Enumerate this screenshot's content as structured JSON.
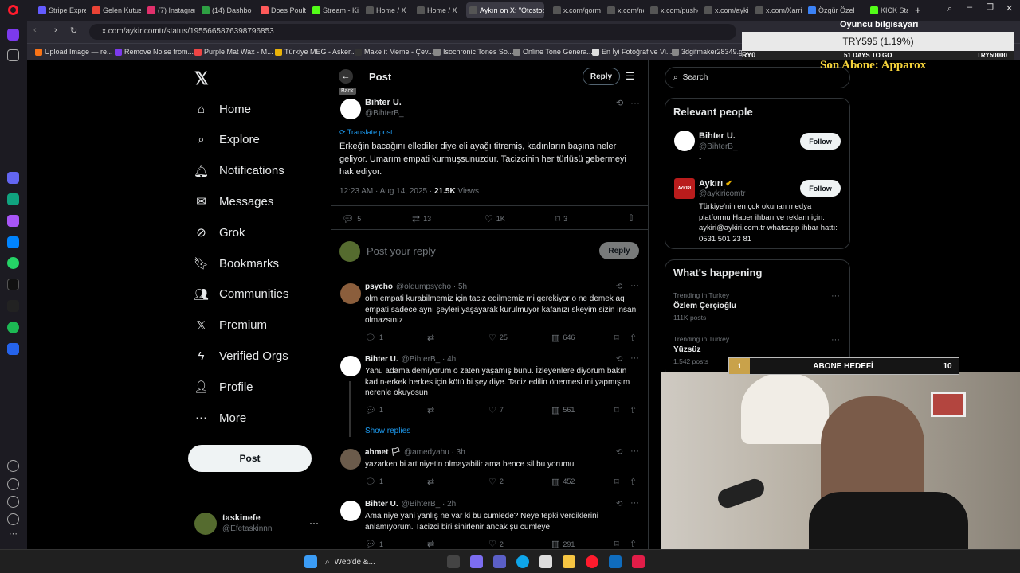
{
  "browser": {
    "tabs": [
      {
        "label": "Stripe Expres",
        "color": "#635bff"
      },
      {
        "label": "Gelen Kutusu",
        "color": "#ea4335"
      },
      {
        "label": "(7) Instagram",
        "color": "#e1306c"
      },
      {
        "label": "(14) Dashbo",
        "color": "#2ea043"
      },
      {
        "label": "Does Poultry",
        "color": "#ff5a5a"
      },
      {
        "label": "Stream - Kick",
        "color": "#53fc18"
      },
      {
        "label": "Home / X",
        "color": "#555"
      },
      {
        "label": "Home / X",
        "color": "#555"
      },
      {
        "label": "Aykırı on X: \"Otostop",
        "color": "#555"
      },
      {
        "label": "x.com/gorm",
        "color": "#555"
      },
      {
        "label": "x.com/nocor",
        "color": "#555"
      },
      {
        "label": "x.com/pushe",
        "color": "#555"
      },
      {
        "label": "x.com/aykir",
        "color": "#555"
      },
      {
        "label": "x.com/Xarria",
        "color": "#555"
      },
      {
        "label": "Özgür Özel",
        "color": "#3b82f6"
      },
      {
        "label": "KICK Status",
        "color": "#53fc18"
      }
    ],
    "url": "x.com/aykiricomtr/status/1955665876398796853",
    "bookmarks": [
      "Upload Image — re...",
      "Remove Noise from...",
      "Purple Mat Wax - M...",
      "Türkiye MEG - Asker...",
      "Make it Meme - Çev...",
      "Isochronic Tones So...",
      "Online Tone Genera...",
      "En İyi Fotoğraf ve Vi...",
      "3dgifmaker28349.gi..."
    ]
  },
  "left_nav": {
    "items": [
      "Home",
      "Explore",
      "Notifications",
      "Messages",
      "Grok",
      "Bookmarks",
      "Communities",
      "Premium",
      "Verified Orgs",
      "Profile",
      "More"
    ],
    "post_button": "Post",
    "account": {
      "name": "taskinefe",
      "handle": "@Efetaskinnn",
      "more": "···"
    }
  },
  "header": {
    "title": "Post",
    "back_tooltip": "Back",
    "reply_button": "Reply"
  },
  "post": {
    "author_name": "Bihter U.",
    "author_handle": "@BihterB_",
    "translate": "Translate post",
    "text": "Erkeğin bacağını ellediler diye eli ayağı titremiş, kadınların başına neler geliyor. Umarım empati kurmuşsunuzdur. Tacizcinin her türlüsü gebermeyi hak ediyor.",
    "timestamp": "12:23 AM · Aug 14, 2025 · ",
    "views_count": "21.5K",
    "views_label": " Views",
    "replies": "5",
    "reposts": "13",
    "likes": "1K",
    "bookmarks": "3"
  },
  "composer": {
    "placeholder": "Post your reply",
    "button": "Reply"
  },
  "replies": [
    {
      "name": "psycho",
      "handle": "@oldumpsycho · 5h",
      "text": "olm empati kurabilmemiz için taciz edilmemiz mi gerekiyor o ne demek aq empati sadece aynı şeyleri yaşayarak kurulmuyor kafanızı skeyim sizin insan olmazsınız",
      "replies": "1",
      "likes": "25",
      "views": "646"
    },
    {
      "name": "Bihter U.",
      "handle": "@BihterB_ · 4h",
      "text": "Yahu adama demiyorum o zaten yaşamış bunu. İzleyenlere diyorum bakın kadın-erkek herkes için kötü bi şey diye. Taciz edilin önermesi mi yapmışım nerenle okuyosun",
      "replies": "1",
      "likes": "7",
      "views": "561"
    },
    {
      "name": "ahmet 🏳",
      "handle": "@amedyahu · 3h",
      "text": "yazarken bi art niyetin olmayabilir ama bence sil bu yorumu",
      "replies": "1",
      "likes": "2",
      "views": "452"
    },
    {
      "name": "Bihter U.",
      "handle": "@BihterB_ · 2h",
      "text": "Ama niye yani yanlış ne var ki bu cümlede? Neye tepki verdiklerini anlamıyorum. Tacizci biri sinirlenir ancak şu cümleye.",
      "replies": "1",
      "likes": "2",
      "views": "291"
    }
  ],
  "show_replies": "Show replies",
  "right": {
    "search_placeholder": "Search",
    "relevant_title": "Relevant people",
    "people": [
      {
        "name": "Bihter U.",
        "handle": "@BihterB_",
        "bio": "-",
        "follow": "Follow"
      },
      {
        "name": "Aykırı",
        "handle": "@aykiricomtr",
        "bio": "Türkiye'nin en çok okunan medya platformu Haber ihbarı ve reklam için: aykiri@aykiri.com.tr whatsapp ihbar hattı: 0531 501 23 81",
        "follow": "Follow",
        "avatar_text": "AYKIRI"
      }
    ],
    "happening_title": "What's happening",
    "trends": [
      {
        "context": "Trending in Turkey",
        "name": "Özlem Çerçioğlu",
        "posts": "111K posts"
      },
      {
        "context": "Trending in Turkey",
        "name": "Yüzsüz",
        "posts": "1,542 posts"
      }
    ]
  },
  "overlays": {
    "currency": "TRY595 (1.19%)",
    "pc_label": "Oyuncu bilgisayarı",
    "progress_left": "RY0",
    "progress_mid": "51 DAYS TO GO",
    "progress_right": "TRY50000",
    "last_sub": "Son Abone: Apparox",
    "goal_current": "1",
    "goal_label": "ABONE HEDEFİ",
    "goal_target": "10"
  },
  "taskbar": {
    "search": "Web'de &..."
  }
}
